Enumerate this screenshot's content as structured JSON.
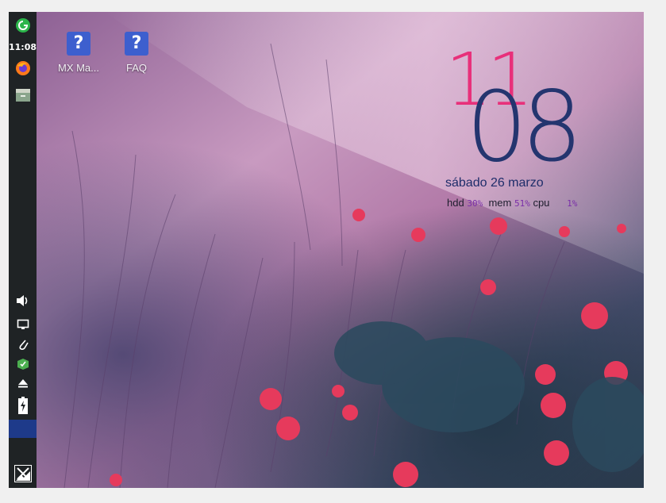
{
  "panel": {
    "clock": "11:08",
    "items": [
      {
        "name": "app-menu-icon",
        "interactable": true
      },
      {
        "name": "firefox-icon",
        "interactable": true
      },
      {
        "name": "file-manager-icon",
        "interactable": true
      },
      {
        "name": "volume-icon",
        "interactable": true
      },
      {
        "name": "display-icon",
        "interactable": true
      },
      {
        "name": "clipboard-icon",
        "interactable": true
      },
      {
        "name": "updater-icon",
        "interactable": true
      },
      {
        "name": "eject-icon",
        "interactable": true
      },
      {
        "name": "battery-icon",
        "interactable": true
      },
      {
        "name": "mx-logo-icon",
        "interactable": true
      }
    ],
    "workspace_color": "#1e3a8a",
    "panel_color": "#1f2325"
  },
  "desktop": {
    "icons": [
      {
        "label": "MX Ma...",
        "glyph": "?"
      },
      {
        "label": "FAQ",
        "glyph": "?"
      }
    ]
  },
  "conky": {
    "hour": "11",
    "minute": "08",
    "date": "sábado  26 marzo",
    "stats": {
      "hdd_label": "hdd",
      "hdd_value": "30%",
      "mem_label": "mem",
      "mem_value": "51%",
      "cpu_label": "cpu",
      "cpu_value": "1%"
    },
    "hour_color": "#e8307a",
    "minute_color": "#24356f"
  }
}
